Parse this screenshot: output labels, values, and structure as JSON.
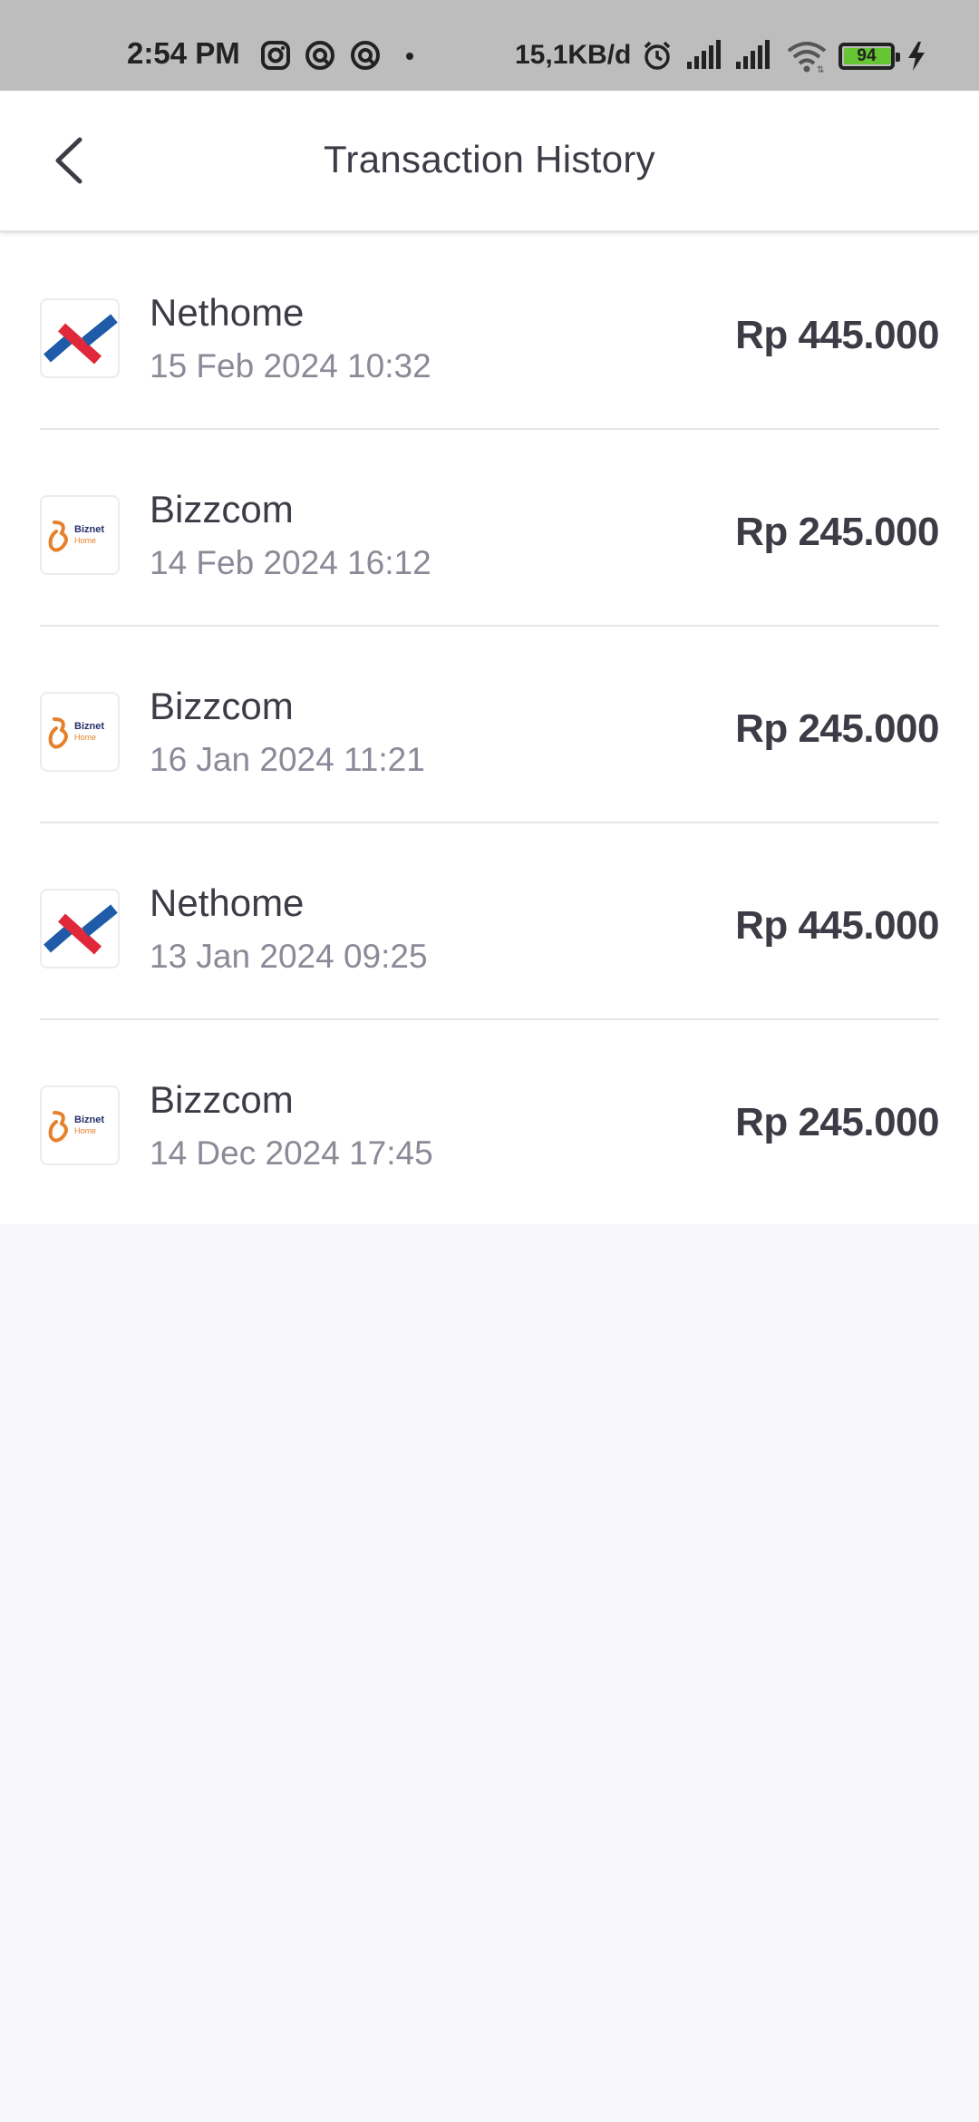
{
  "status_bar": {
    "time": "2:54 PM",
    "network_speed": "15,1KB/d",
    "battery_level": "94",
    "icons": [
      "instagram-icon",
      "app-notification-icon",
      "app-notification-icon",
      "alarm-icon",
      "signal-icon",
      "signal-icon",
      "wifi-icon",
      "battery-icon",
      "charging-icon"
    ]
  },
  "header": {
    "title": "Transaction History",
    "back_icon": "chevron-left-icon"
  },
  "transactions": [
    {
      "provider": "Nethome",
      "logo": "nethome-logo",
      "date": "15 Feb 2024 10:32",
      "amount": "Rp 445.000"
    },
    {
      "provider": "Bizzcom",
      "logo": "biznet-logo",
      "logo_text": "Biznet",
      "logo_subtext": "Home",
      "date": "14 Feb 2024 16:12",
      "amount": "Rp 245.000"
    },
    {
      "provider": "Bizzcom",
      "logo": "biznet-logo",
      "logo_text": "Biznet",
      "logo_subtext": "Home",
      "date": "16 Jan 2024 11:21",
      "amount": "Rp 245.000"
    },
    {
      "provider": "Nethome",
      "logo": "nethome-logo",
      "date": "13 Jan 2024 09:25",
      "amount": "Rp 445.000"
    },
    {
      "provider": "Bizzcom",
      "logo": "biznet-logo",
      "logo_text": "Biznet",
      "logo_subtext": "Home",
      "date": "14 Dec 2024 17:45",
      "amount": "Rp 245.000"
    }
  ],
  "colors": {
    "status_bar_bg": "#bdbdbd",
    "page_bg": "#f8f8fa",
    "text_primary": "#3c3c46",
    "text_secondary": "#8a8a98",
    "nethome_blue": "#1f5ba8",
    "nethome_red": "#e0283a",
    "biznet_orange": "#e6812b",
    "battery_green": "#66c533"
  }
}
